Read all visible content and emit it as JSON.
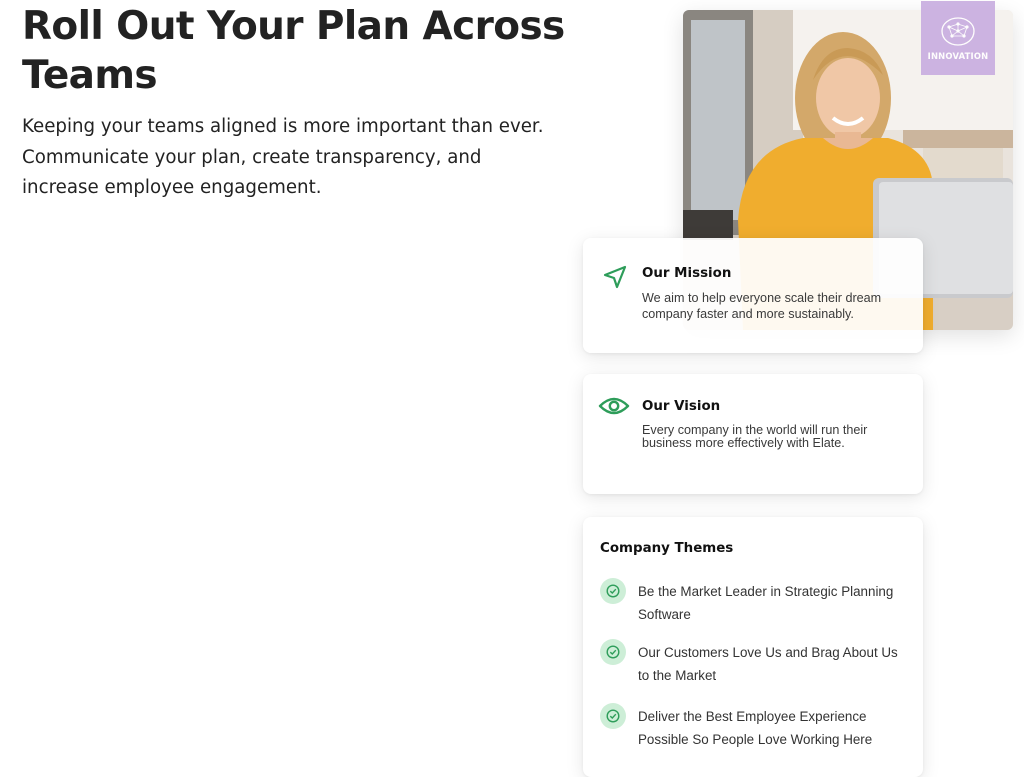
{
  "hero": {
    "title": "Roll Out Your Plan Across Teams",
    "subtitle": "Keeping your teams aligned is more important than ever. Communicate your plan, create transparency, and increase employee engagement."
  },
  "image": {
    "subject": "smiling-woman-at-laptop-photo",
    "badge_label": "INNOVATION"
  },
  "mission": {
    "icon": "send-arrow-icon",
    "title": "Our Mission",
    "text": "We aim to help everyone scale their dream company faster and more sustainably."
  },
  "vision": {
    "icon": "eye-icon",
    "title": "Our Vision",
    "text": "Every company in the world will run their business more effectively with Elate."
  },
  "themes": {
    "title": "Company Themes",
    "items": [
      {
        "label": "Be the Market Leader in Strategic Planning Software",
        "icon": "check-circle-icon"
      },
      {
        "label": "Our Customers Love Us and Brag About Us to the Market",
        "icon": "check-circle-icon"
      },
      {
        "label": "Deliver the Best Employee Experience Possible So People Love Working Here",
        "icon": "check-circle-icon"
      }
    ]
  },
  "colors": {
    "accent_green": "#2e9d5a",
    "check_bg": "#cdeed7",
    "heading": "#222222",
    "badge": "#c9aee0"
  }
}
